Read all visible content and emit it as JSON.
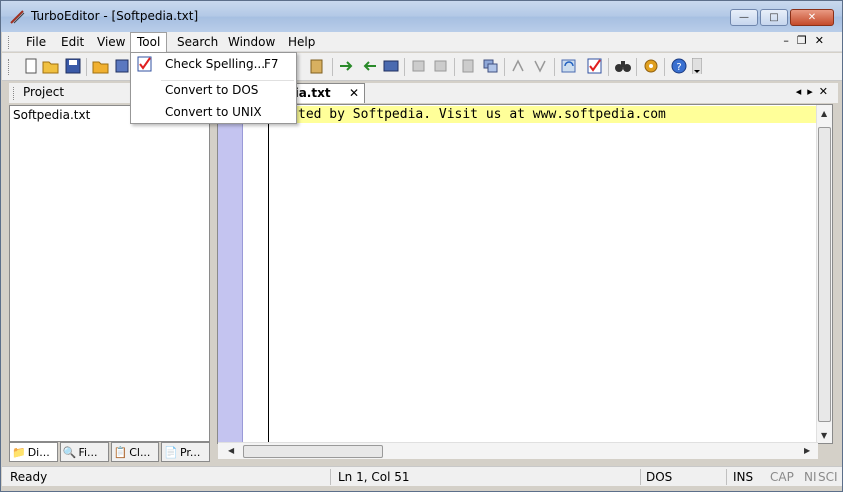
{
  "window": {
    "title": "TurboEditor - [Softpedia.txt]"
  },
  "menu": {
    "items": [
      "File",
      "Edit",
      "View",
      "Tool",
      "Search",
      "Window",
      "Help"
    ],
    "open_item": "Tool"
  },
  "tool_menu": {
    "items": [
      {
        "label": "Check Spelling...",
        "shortcut": "F7",
        "icon": "spellcheck-icon"
      },
      {
        "label": "Convert to DOS",
        "shortcut": ""
      },
      {
        "label": "Convert to UNIX",
        "shortcut": ""
      }
    ]
  },
  "project_panel": {
    "title": "Project",
    "files": [
      "Softpedia.txt"
    ],
    "tabs": [
      "Di...",
      "Fi...",
      "Cl...",
      "Pr..."
    ]
  },
  "editor": {
    "tab_label": "dia.txt",
    "tab_close": "✕",
    "visible_text": "ted by Softpedia. Visit us at www.softpedia.com"
  },
  "status": {
    "state": "Ready",
    "position": "Ln 1, Col 51",
    "line_ending": "DOS",
    "ins": "INS",
    "cap": "CAP",
    "num": "NI",
    "scrl": "SCI"
  },
  "colors": {
    "current_line": "#ffff99",
    "gutter": "#c4c4f0",
    "titlebar": "#b2c8e6"
  }
}
